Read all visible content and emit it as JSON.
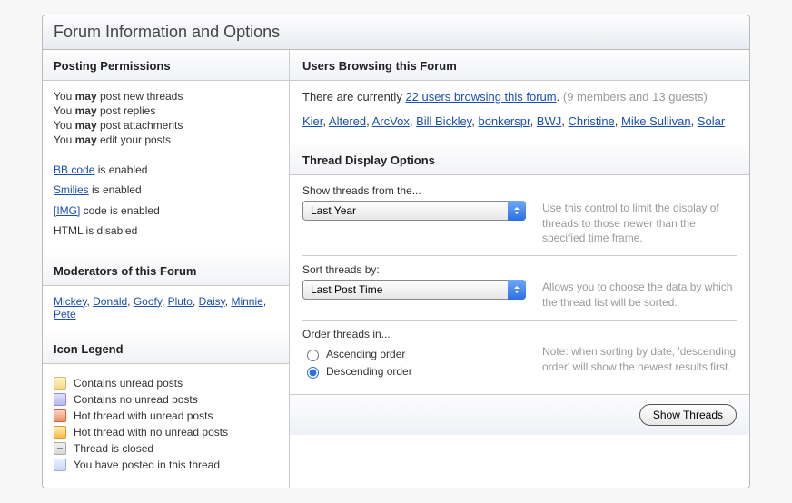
{
  "panel_title": "Forum Information and Options",
  "posting": {
    "title": "Posting Permissions",
    "you": "You",
    "may": "may",
    "p1": "post new threads",
    "p2": "post replies",
    "p3": "post attachments",
    "p4": "edit your posts",
    "bbcode_link": "BB code",
    "bbcode_rest": " is enabled",
    "smilies_link": "Smilies",
    "smilies_rest": " is enabled",
    "img_link": "[IMG]",
    "img_rest": " code is enabled",
    "html": "HTML is disabled"
  },
  "moderators": {
    "title": "Moderators of this Forum",
    "list": [
      "Mickey",
      "Donald",
      "Goofy",
      "Pluto",
      "Daisy",
      "Minnie",
      "Pete"
    ]
  },
  "legend": {
    "title": "Icon Legend",
    "unread": "Contains unread posts",
    "nounread": "Contains no unread posts",
    "hot_unread": "Hot thread with unread posts",
    "hot_nounread": "Hot thread with no unread posts",
    "closed": "Thread is closed",
    "posted": "You have posted in this thread"
  },
  "browsers": {
    "title": "Users Browsing this Forum",
    "prefix": "There are currently ",
    "count_link": "22 users browsing this forum",
    "period": ".",
    "suffix": " (9 members and 13 guests)",
    "users": [
      "Kier",
      "Altered",
      "ArcVox",
      "Bill Bickley",
      "bonkerspr",
      "BWJ",
      "Christine",
      "Mike Sullivan",
      "Solar"
    ]
  },
  "display": {
    "title": "Thread Display Options",
    "show_label": "Show threads from the...",
    "show_value": "Last Year",
    "show_desc": "Use this control to limit the display of threads to those newer than the specified time frame.",
    "sort_label": "Sort threads by:",
    "sort_value": "Last Post Time",
    "sort_desc": "Allows you to choose the data by which the thread list will be sorted.",
    "order_label": "Order threads in...",
    "asc": "Ascending order",
    "desc": "Descending order",
    "order_desc": "Note: when sorting by date, 'descending order' will show the newest results first.",
    "submit": "Show Threads"
  }
}
